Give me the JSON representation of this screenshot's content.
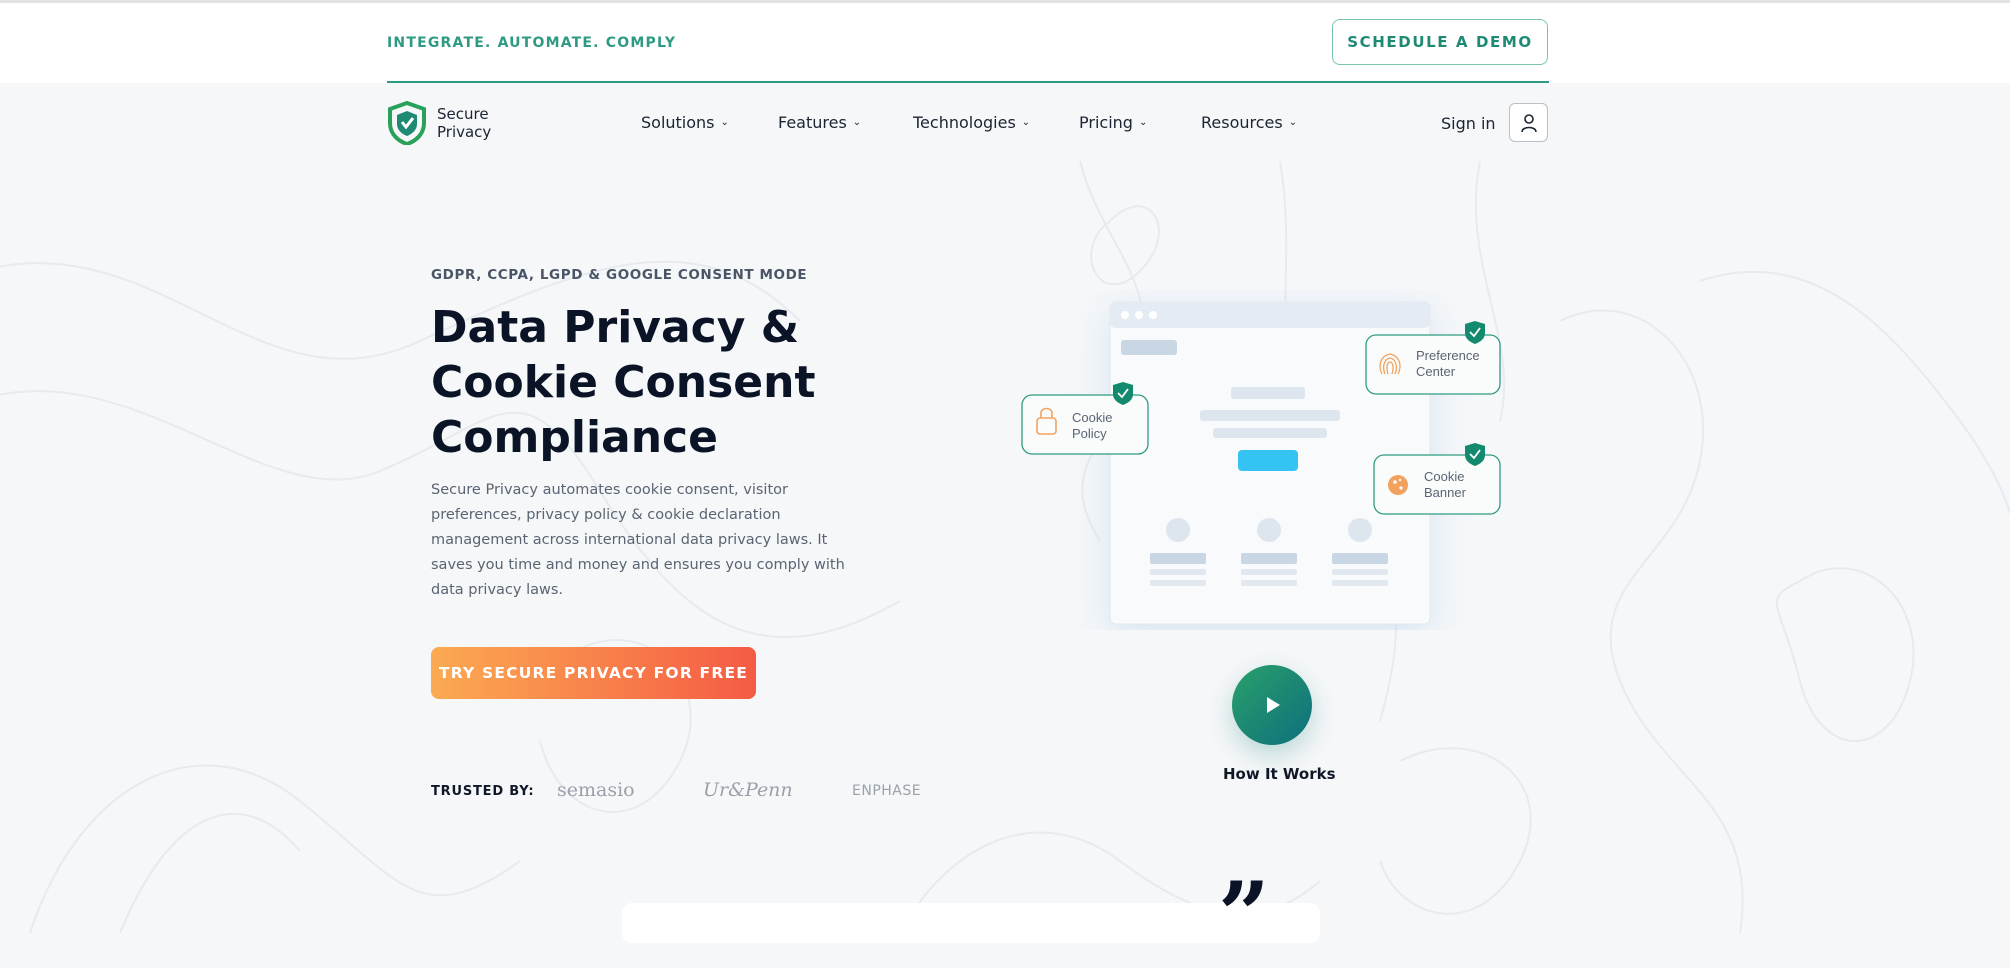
{
  "topbar": {
    "tagline": "INTEGRATE. AUTOMATE. COMPLY",
    "demo_button": "SCHEDULE A DEMO"
  },
  "logo": {
    "line1": "Secure",
    "line2": "Privacy",
    "icon": "shield-icon"
  },
  "nav": {
    "items": [
      {
        "label": "Solutions"
      },
      {
        "label": "Features"
      },
      {
        "label": "Technologies"
      },
      {
        "label": "Pricing"
      },
      {
        "label": "Resources"
      }
    ],
    "signin": "Sign in",
    "user_icon": "user-icon"
  },
  "hero": {
    "eyebrow": "GDPR, CCPA, LGPD & GOOGLE CONSENT MODE",
    "title_line1": "Data Privacy &",
    "title_line2": "Cookie Consent",
    "title_line3": "Compliance",
    "description": "Secure Privacy automates cookie consent, visitor preferences, privacy policy & cookie declaration management across international data privacy laws. It saves you time and money and ensures you comply with data privacy laws.",
    "cta": "TRY SECURE PRIVACY FOR FREE"
  },
  "trusted": {
    "label": "TRUSTED BY:",
    "brands": [
      "semasio",
      "Ur&Penn",
      "ENPHASE"
    ]
  },
  "illustration": {
    "cards": [
      {
        "line1": "Cookie",
        "line2": "Policy",
        "icon": "lock-icon"
      },
      {
        "line1": "Preference",
        "line2": "Center",
        "icon": "fingerprint-icon"
      },
      {
        "line1": "Cookie",
        "line2": "Banner",
        "icon": "cookie-icon"
      }
    ]
  },
  "video": {
    "label": "How It Works",
    "icon": "play-icon"
  },
  "colors": {
    "accent": "#2f9a83",
    "cta_start": "#fbaa52",
    "cta_end": "#f55b44",
    "dark": "#0b1426"
  }
}
